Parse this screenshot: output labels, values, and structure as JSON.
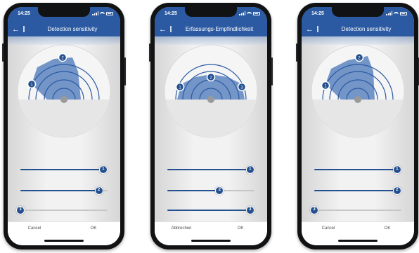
{
  "status_time": "14:25",
  "colors": {
    "appbar": "#2b5aa2",
    "zone_fill": "#5c84c0",
    "thumb": "#24508f",
    "track": "#c6c6c6"
  },
  "phones": [
    {
      "title": "Detection sensitivity",
      "zones": [
        "1",
        "2"
      ],
      "sliders": [
        {
          "label": "1",
          "value": 0.95
        },
        {
          "label": "2",
          "value": 0.9
        },
        {
          "label": "3",
          "value": 0.0
        }
      ],
      "buttons": {
        "cancel": "Cancel",
        "ok": "OK"
      }
    },
    {
      "title": "Erfassungs-Empfindlichkeit",
      "zones": [
        "1",
        "2",
        "3"
      ],
      "sliders": [
        {
          "label": "1",
          "value": 0.95
        },
        {
          "label": "2",
          "value": 0.6
        },
        {
          "label": "3",
          "value": 0.95
        }
      ],
      "buttons": {
        "cancel": "Abbrechen",
        "ok": "OK"
      }
    },
    {
      "title": "Detection sensitivity",
      "zones": [
        "1",
        "2"
      ],
      "sliders": [
        {
          "label": "1",
          "value": 0.95
        },
        {
          "label": "2",
          "value": 0.95
        },
        {
          "label": "3",
          "value": 0.0
        }
      ],
      "buttons": {
        "cancel": "Cancel",
        "ok": "OK"
      }
    }
  ]
}
